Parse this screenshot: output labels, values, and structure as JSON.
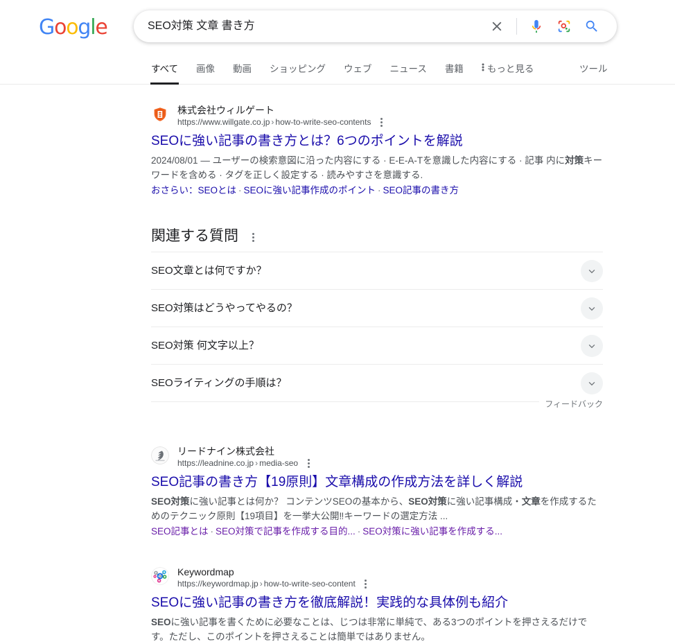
{
  "header": {
    "logo_letters": [
      {
        "ch": "G",
        "color": "#4285f4"
      },
      {
        "ch": "o",
        "color": "#ea4335"
      },
      {
        "ch": "o",
        "color": "#fbbc05"
      },
      {
        "ch": "g",
        "color": "#4285f4"
      },
      {
        "ch": "l",
        "color": "#34a853"
      },
      {
        "ch": "e",
        "color": "#ea4335"
      }
    ],
    "search": {
      "value": "SEO対策 文章 書き方",
      "placeholder": "検索",
      "clear_icon": "close-icon",
      "mic_icon": "microphone-icon",
      "lens_icon": "google-lens-icon",
      "search_icon": "search-icon"
    },
    "tabs": [
      {
        "label": "すべて",
        "active": true
      },
      {
        "label": "画像",
        "active": false
      },
      {
        "label": "動画",
        "active": false
      },
      {
        "label": "ショッピング",
        "active": false
      },
      {
        "label": "ウェブ",
        "active": false
      },
      {
        "label": "ニュース",
        "active": false
      },
      {
        "label": "書籍",
        "active": false
      },
      {
        "label": "もっと見る",
        "active": false,
        "has_dots": true
      }
    ],
    "tools_label": "ツール"
  },
  "results": [
    {
      "site_name": "株式会社ウィルゲート",
      "url_domain": "https://www.willgate.co.jp",
      "url_path": "how-to-write-seo-contents",
      "title": "SEOに強い記事の書き方とは？6つのポイントを解説",
      "snippet_line1": "2024/08/01 — ユーザーの検索意図に沿った内容にする · E-E-A-Tを意識した内容にする · 記事",
      "snippet_line2_pre": "内に",
      "snippet_line2_bold": "対策",
      "snippet_line2_post": "キーワードを含める · タグを正しく設定する · 読みやすさを意識する.",
      "sitelinks": [
        "おさらい：SEOとは",
        "SEOに強い記事作成のポイント",
        "SEO記事の書き方"
      ],
      "sitelinks_visited": false,
      "favicon": "willgate-shield-icon"
    },
    {
      "site_name": "リードナイン株式会社",
      "url_domain": "https://leadnine.co.jp",
      "url_path": "media-seo",
      "title": "SEO記事の書き方【19原則】文章構成の作成方法を詳しく解説",
      "snippet_line1_bold": "SEO対策",
      "snippet_line1_mid": "に強い記事とは何か？ コンテンツSEOの基本から、",
      "snippet_line1_bold2": "SEO対策",
      "snippet_line1_end": "に強い記事構成・",
      "snippet_line1_bold3": "文章",
      "snippet_line1_tail": "を",
      "snippet_line2": "作成するためのテクニック原則【19項目】を一挙大公開‼キーワードの選定方法 ...",
      "sitelinks": [
        "SEO記事とは",
        "SEO対策で記事を作成する目的...",
        "SEO対策に強い記事を作成する..."
      ],
      "sitelinks_visited": true,
      "favicon": "leadnine-leaf-icon"
    },
    {
      "site_name": "Keywordmap",
      "url_domain": "https://keywordmap.jp",
      "url_path": "how-to-write-seo-content",
      "title": "SEOに強い記事の書き方を徹底解説！実践的な具体例も紹介",
      "snippet_line1_bold": "SEO",
      "snippet_line1_rest": "に強い記事を書くために必要なことは、じつは非常に単純で、ある3つのポイントを押さえ",
      "snippet_line2": "るだけです。ただし、このポイントを押さえることは簡単ではありません。",
      "favicon": "keywordmap-network-icon"
    }
  ],
  "people_also_ask": {
    "heading": "関連する質問",
    "kebab_icon": "more-options-icon",
    "questions": [
      "SEO文章とは何ですか？",
      "SEO対策はどうやってやるの？",
      "SEO対策 何文字以上？",
      "SEOライティングの手順は？"
    ],
    "expand_icon": "chevron-down-icon",
    "feedback_label": "フィードバック"
  }
}
